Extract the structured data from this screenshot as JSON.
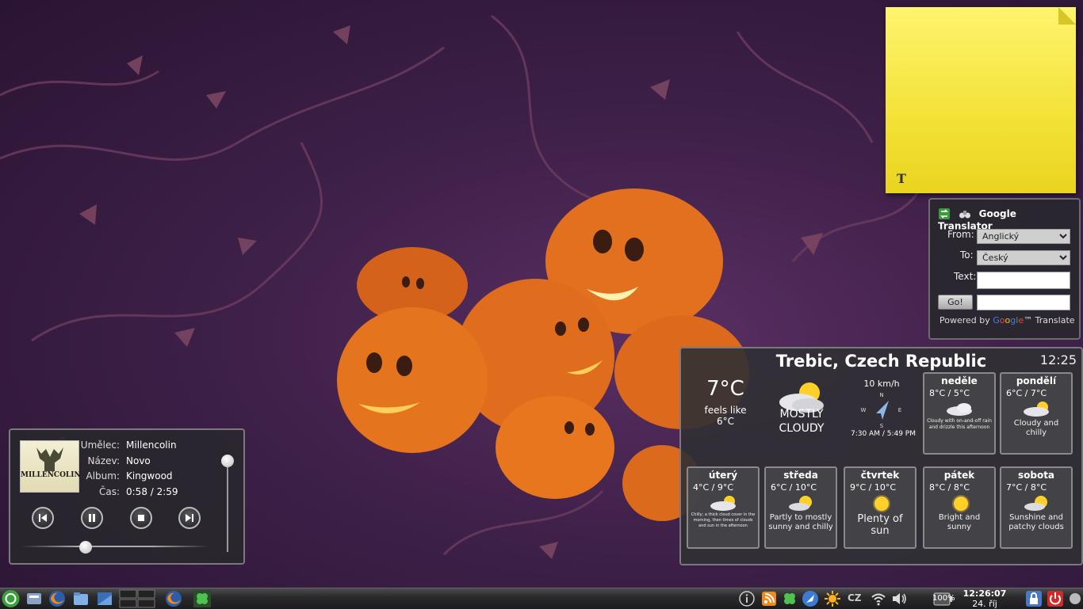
{
  "translator": {
    "title": "Google Translator",
    "from_label": "From:",
    "from_value": "Anglický",
    "to_label": "To:",
    "to_value": "Český",
    "text_label": "Text:",
    "go_label": "Go!",
    "powered_prefix": "Powered by",
    "powered_brand": [
      "G",
      "o",
      "o",
      "g",
      "l",
      "e"
    ],
    "powered_suffix": "™ Translate"
  },
  "weather": {
    "location": "Trebic, Czech Republic",
    "clock": "12:25",
    "current": {
      "temp": "7°C",
      "feels_label": "feels like",
      "feels_value": "6°C",
      "condition_line1": "MOSTLY",
      "condition_line2": "CLOUDY",
      "wind": "10 km/h",
      "compass_n": "N",
      "compass_s": "S",
      "compass_e": "E",
      "compass_w": "W",
      "sun_times": "7:30 AM / 5:49 PM"
    },
    "days": [
      {
        "name": "neděle",
        "temps": "8°C / 5°C",
        "desc": "Cloudy with on-and-off rain and drizzle this afternoon",
        "icon": "cloud-icon"
      },
      {
        "name": "pondělí",
        "temps": "6°C / 7°C",
        "desc": "Cloudy and chilly",
        "icon": "partly-cloudy-icon"
      },
      {
        "name": "úterý",
        "temps": "4°C / 9°C",
        "desc": "Chilly; a thick cloud cover in the morning, then times of clouds and sun in the afternoon",
        "icon": "partly-cloudy-icon"
      },
      {
        "name": "středa",
        "temps": "6°C / 10°C",
        "desc": "Partly to mostly sunny and chilly",
        "icon": "partly-sunny-icon"
      },
      {
        "name": "čtvrtek",
        "temps": "9°C / 10°C",
        "desc": "Plenty of sun",
        "icon": "sun-icon"
      },
      {
        "name": "pátek",
        "temps": "8°C / 8°C",
        "desc": "Bright and sunny",
        "icon": "sun-icon"
      },
      {
        "name": "sobota",
        "temps": "7°C / 8°C",
        "desc": "Sunshine and patchy clouds",
        "icon": "partly-sunny-icon"
      }
    ]
  },
  "player": {
    "album_art_text": "MILLENCOLIN",
    "artist_label": "Umělec:",
    "artist": "Millencolin",
    "title_label": "Název:",
    "title": "Novo",
    "album_label": "Album:",
    "album": "Kingwood",
    "time_label": "Čas:",
    "time": "0:58 / 2:59",
    "volume_level": 1.0,
    "position_fraction": 0.33
  },
  "note": {
    "text": "",
    "icon_glyph": "T"
  },
  "taskbar": {
    "keyboard_layout": "CZ",
    "battery": "100%",
    "time": "12:26:07",
    "date": "24. říj"
  },
  "colors": {
    "wallpaper": "#3e2048",
    "note": "#f3e236",
    "widget_bg": "#303034",
    "pumpkin": "#e8731f"
  }
}
